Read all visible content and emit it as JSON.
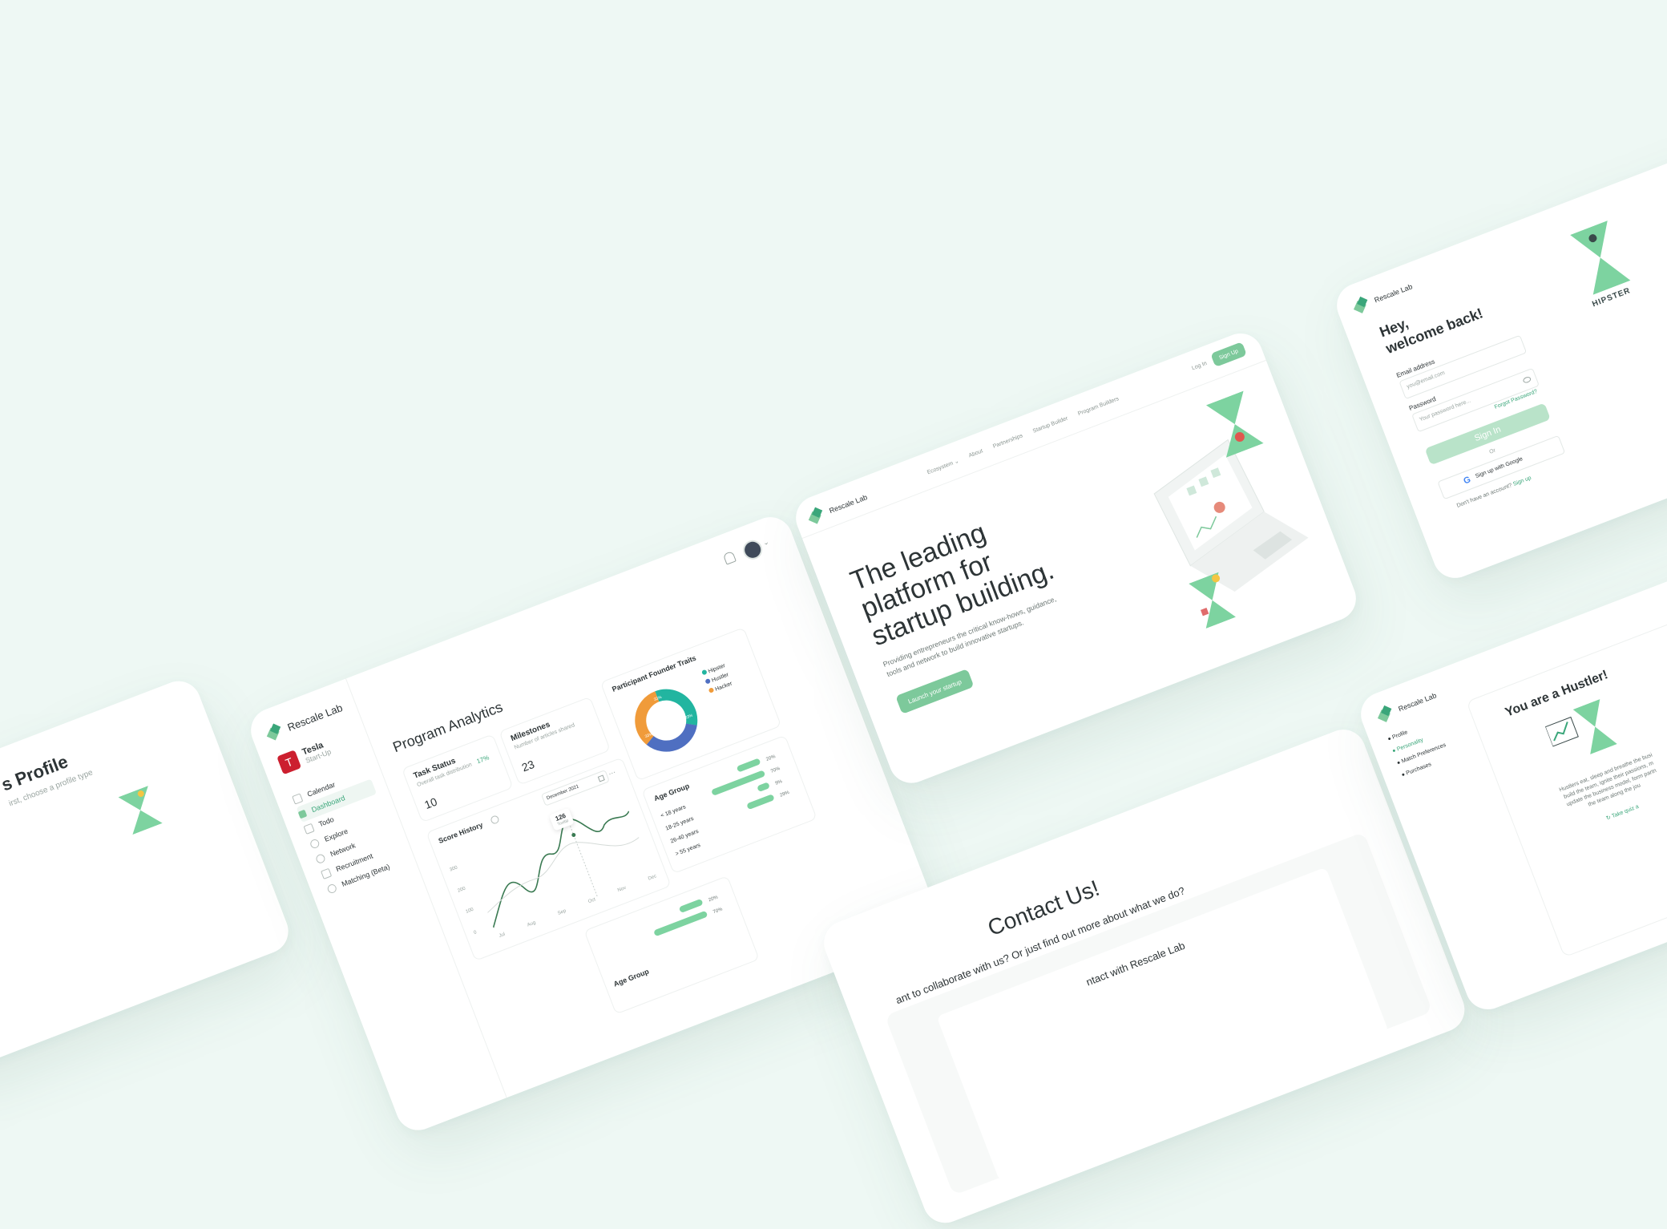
{
  "dashboard": {
    "brand": "Rescale Lab",
    "org_name": "Tesla",
    "org_sub": "Start-Up",
    "nav": [
      "Calendar",
      "Dashboard",
      "Todo",
      "Explore",
      "Network",
      "Recruitment",
      "Matching (Beta)"
    ],
    "title": "Program Analytics",
    "task_status_title": "Task Status",
    "task_status_sub": "Overall task distribution",
    "task_status_value": "10",
    "task_status_pct": "17%",
    "milestones_title": "Milestones",
    "milestones_sub": "Number of articles shared",
    "milestones_value": "23",
    "traits_title": "Participant Founder Traits",
    "legend": [
      "Hipster",
      "Hustler",
      "Hacker"
    ],
    "donut_labels": [
      "33%",
      "33%",
      "33%"
    ],
    "score_title": "Score History",
    "score_month": "December 2021",
    "score_tooltip_value": "126",
    "score_tooltip_sub": "Tooltip",
    "y_ticks": [
      "300",
      "200",
      "100",
      "0"
    ],
    "x_ticks": [
      "Jul",
      "Aug",
      "Sep",
      "Oct",
      "Nov",
      "Dec"
    ],
    "age_title": "Age Group",
    "age_groups": [
      "< 18 years",
      "18-25 years",
      "26-40 years",
      "> 55 years"
    ],
    "age_pcts": [
      "20%",
      "70%",
      "9%",
      "29%"
    ],
    "age_group_title_2": "Age Group",
    "age_pcts_2": [
      "20%",
      "70%"
    ],
    "colors": {
      "teal": "#22b5a0",
      "blue": "#4f6fc1",
      "orange": "#f09b3a",
      "green": "#3aa67a"
    }
  },
  "landing": {
    "brand": "Rescale Lab",
    "nav": [
      "Ecosystem",
      "About",
      "Partnerships",
      "Startup Builder",
      "Program Builders"
    ],
    "login": "Log In",
    "signup": "Sign Up",
    "headline": [
      "The leading",
      "platform for",
      "startup building."
    ],
    "subtext": [
      "Providing entrepreneurs the critical know-hows, guidance,",
      "tools and network to build innovative startups."
    ],
    "cta": "Launch your startup"
  },
  "login": {
    "brand": "Rescale Lab",
    "greeting": [
      "Hey,",
      "welcome back!"
    ],
    "email_label": "Email address",
    "email_placeholder": "you@email.com",
    "password_label": "Password",
    "password_placeholder": "Your password here...",
    "forgot": "Forgot Password?",
    "signin": "Sign In",
    "or": "Or",
    "google": "Sign up with Google",
    "no_account": "Don't have an account?",
    "signup_link": "Sign up",
    "side_label": "HIPSTER"
  },
  "profile_left": {
    "title": "s Profile",
    "sub": "irst, choose a profile type"
  },
  "contact": {
    "title": "Contact Us!",
    "sub": "ant to collaborate with us? Or just find out more about what we do?",
    "form_title": "ntact with Rescale Lab"
  },
  "hustler": {
    "brand": "Rescale Lab",
    "nav": [
      "Profile",
      "Personality",
      "Match Preferences",
      "Purchases"
    ],
    "title": "You are a Hustler!",
    "body": [
      "Hustlers eat, sleep and breathe the busi",
      "build the team, ignite their passions, m",
      "update the business model, form partn",
      "the team along the jou"
    ],
    "link": "Take quiz a"
  }
}
